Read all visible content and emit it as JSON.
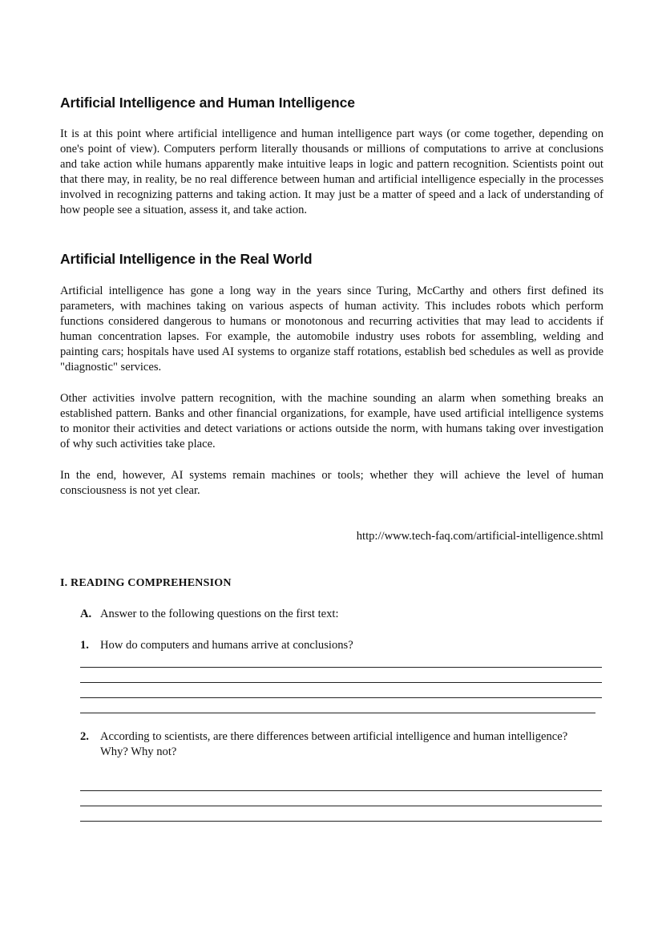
{
  "sections": [
    {
      "heading": "Artificial Intelligence and Human Intelligence",
      "paragraphs": [
        "It is at this point where artificial intelligence and human intelligence part ways (or come together, depending on one's point of view). Computers perform literally thousands or millions of computations to arrive at conclusions and take action while humans apparently make intuitive leaps in logic and pattern recognition. Scientists point out that there may, in reality, be no real difference between human and artificial intelligence especially in the processes involved in recognizing patterns and taking action. It may just be a matter of speed and a lack of understanding of how people see a situation, assess it, and take action."
      ]
    },
    {
      "heading": "Artificial Intelligence in the Real World",
      "paragraphs": [
        "Artificial intelligence has gone a long way in the years since Turing, McCarthy and others first defined its parameters, with machines taking on various aspects of human activity. This includes robots which perform functions considered dangerous to humans or monotonous and recurring activities that may lead to accidents if human concentration lapses. For example, the automobile industry uses robots for assembling, welding and painting cars; hospitals have used AI systems to organize staff rotations, establish bed schedules as well as provide \"diagnostic\" services.",
        "Other activities involve pattern recognition, with the machine sounding an alarm when something breaks an established pattern. Banks and other financial organizations, for example, have used artificial intelligence systems to monitor their activities and detect variations or actions outside the norm, with humans taking over investigation of why such activities take place.",
        "In the end, however, AI systems remain machines or tools; whether they will achieve the level of human consciousness is not yet clear."
      ]
    }
  ],
  "source_url": "http://www.tech-faq.com/artificial-intelligence.shtml",
  "exercise": {
    "title": "I. READING COMPREHENSION",
    "instruction": {
      "label": "A.",
      "text": "Answer to the following questions on the first text:"
    },
    "questions": [
      {
        "number": "1.",
        "text": "How do computers and humans arrive at conclusions?"
      },
      {
        "number": "2.",
        "text": "According to scientists, are there differences between artificial intelligence and human intelligence?  Why? Why not?"
      }
    ]
  }
}
